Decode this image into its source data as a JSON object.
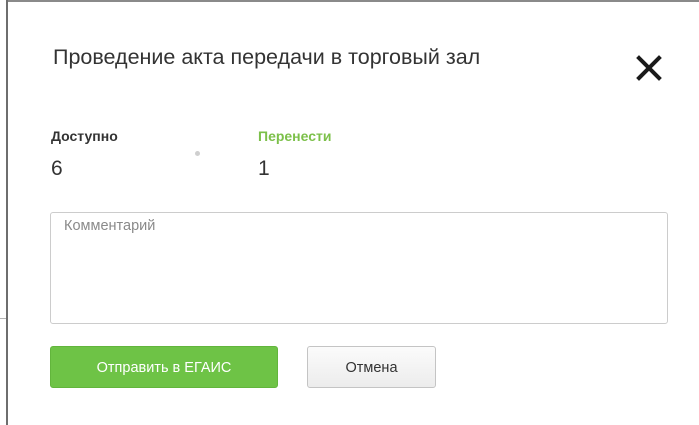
{
  "dialog": {
    "title": "Проведение акта передачи в торговый зал",
    "close_icon": "close-icon"
  },
  "stats": {
    "available": {
      "label": "Доступно",
      "value": "6"
    },
    "transfer": {
      "label": "Перенести",
      "value": "1",
      "label_color": "#7cc04a"
    }
  },
  "comment": {
    "placeholder": "Комментарий",
    "value": ""
  },
  "actions": {
    "submit_label": "Отправить в ЕГАИС",
    "cancel_label": "Отмена",
    "submit_color": "#6ec346"
  }
}
